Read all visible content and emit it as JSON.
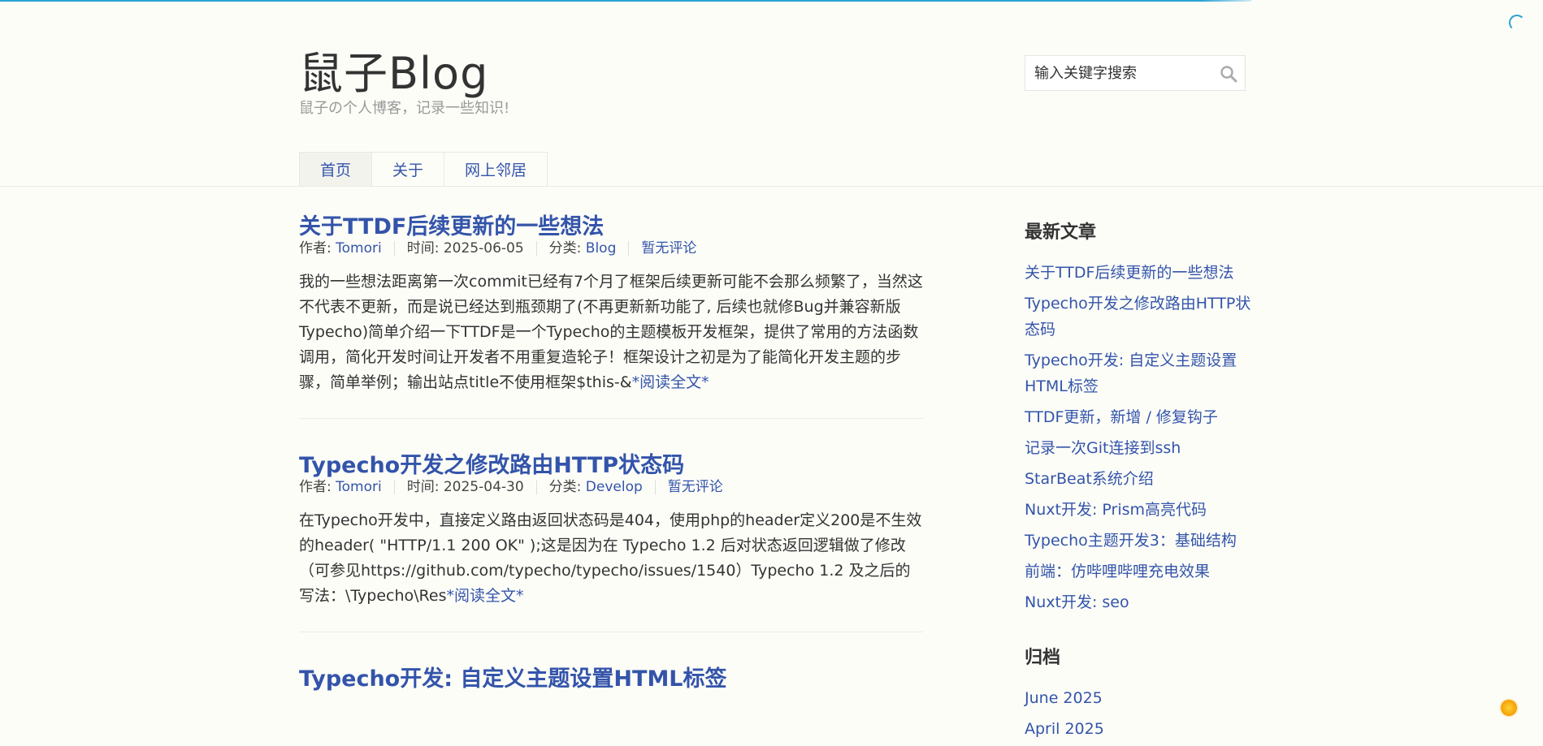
{
  "site": {
    "title": "鼠子Blog",
    "description": "鼠子の个人博客，记录一些知识!"
  },
  "search": {
    "placeholder": "输入关键字搜索",
    "icon": "search-icon"
  },
  "nav": {
    "items": [
      {
        "label": "首页"
      },
      {
        "label": "关于"
      },
      {
        "label": "网上邻居"
      }
    ]
  },
  "meta_labels": {
    "author": "作者: ",
    "time": "时间: ",
    "category": "分类: "
  },
  "posts": [
    {
      "title": "关于TTDF后续更新的一些想法",
      "author": "Tomori",
      "date": "2025-06-05",
      "category": "Blog",
      "comments": "暂无评论",
      "excerpt": "我的一些想法距离第一次commit已经有7个月了框架后续更新可能不会那么频繁了，当然这不代表不更新，而是说已经达到瓶颈期了(不再更新新功能了, 后续也就修Bug并兼容新版Typecho)简单介绍一下TTDF是一个Typecho的主题模板开发框架，提供了常用的方法函数调用，简化开发时间让开发者不用重复造轮子！框架设计之初是为了能简化开发主题的步骤，简单举例；输出站点title不使用框架$this-&",
      "read_more": "*阅读全文*"
    },
    {
      "title": "Typecho开发之修改路由HTTP状态码",
      "author": "Tomori",
      "date": "2025-04-30",
      "category": "Develop",
      "comments": "暂无评论",
      "excerpt": "在Typecho开发中，直接定义路由返回状态码是404，使用php的header定义200是不生效的header( \"HTTP/1.1 200 OK\" );这是因为在 Typecho 1.2 后对状态返回逻辑做了修改（可参见https://github.com/typecho/typecho/issues/1540）Typecho 1.2 及之后的写法：\\Typecho\\Res",
      "read_more": "*阅读全文*"
    },
    {
      "title": "Typecho开发: 自定义主题设置HTML标签"
    }
  ],
  "sidebar": {
    "recent_title": "最新文章",
    "recent": [
      "关于TTDF后续更新的一些想法",
      "Typecho开发之修改路由HTTP状态码",
      "Typecho开发: 自定义主题设置HTML标签",
      "TTDF更新，新增 / 修复钩子",
      "记录一次Git连接到ssh",
      "StarBeat系统介绍",
      "Nuxt开发: Prism高亮代码",
      "Typecho主题开发3：基础结构",
      "前端：仿哔哩哔哩充电效果",
      "Nuxt开发: seo"
    ],
    "archive_title": "归档",
    "archives": [
      "June 2025",
      "April 2025"
    ]
  },
  "colors": {
    "background": "#fdfdf8",
    "link": "#3354aa",
    "progress": "#29a3d6",
    "badge": "#f4a000"
  }
}
